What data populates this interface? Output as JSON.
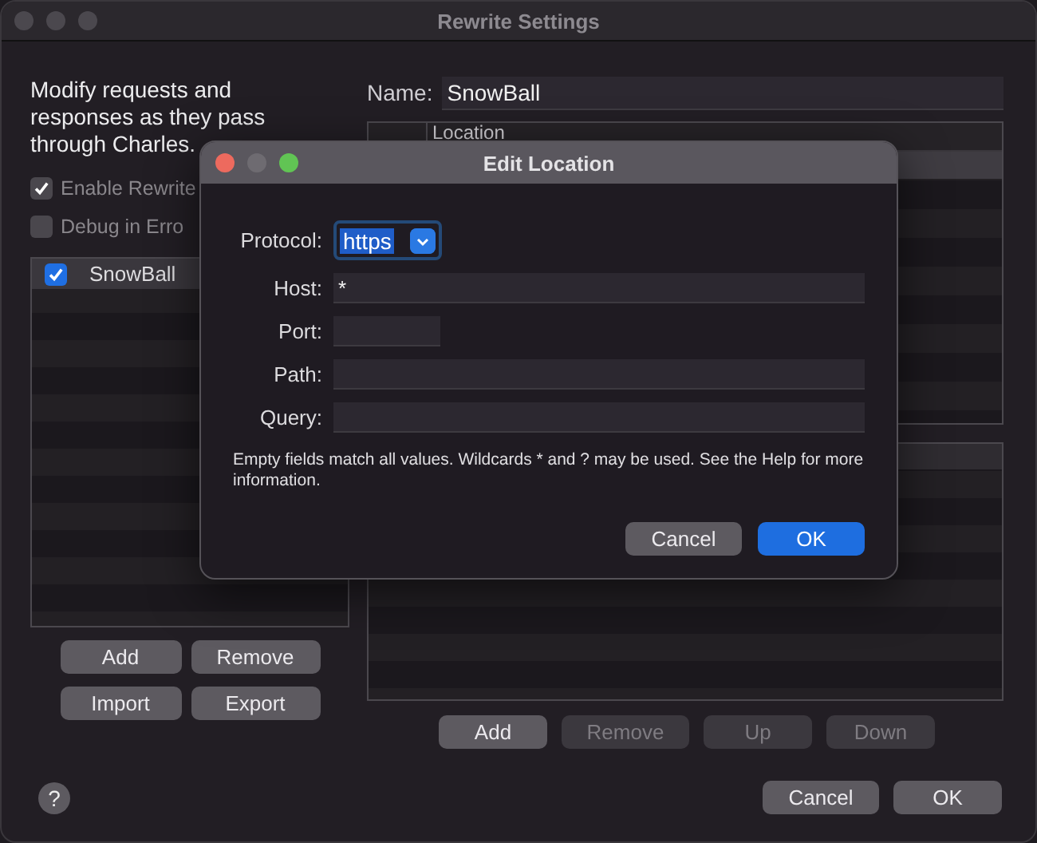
{
  "window": {
    "title": "Rewrite Settings"
  },
  "description": "Modify requests and responses as they pass through Charles.",
  "options": [
    {
      "label": "Enable Rewrite",
      "checked": true
    },
    {
      "label": "Debug in Erro",
      "checked": false
    }
  ],
  "sets": [
    {
      "name": "SnowBall",
      "checked": true,
      "selected": true
    }
  ],
  "set_buttons": [
    {
      "label": "Add",
      "disabled": false
    },
    {
      "label": "Remove",
      "disabled": false
    },
    {
      "label": "Import",
      "disabled": false
    },
    {
      "label": "Export",
      "disabled": false
    }
  ],
  "name_field": {
    "label": "Name:",
    "value": "SnowBall"
  },
  "locations_table": {
    "columns": [
      "Location"
    ]
  },
  "rule_buttons": [
    {
      "label": "Add",
      "disabled": false
    },
    {
      "label": "Remove",
      "disabled": true
    },
    {
      "label": "Up",
      "disabled": true
    },
    {
      "label": "Down",
      "disabled": true
    }
  ],
  "help": "?",
  "footer_buttons": [
    {
      "label": "Cancel",
      "default": false
    },
    {
      "label": "OK",
      "default": false
    }
  ],
  "dialog": {
    "title": "Edit Location",
    "fields": [
      {
        "label": "Protocol:",
        "kind": "select",
        "value": "https"
      },
      {
        "label": "Host:",
        "kind": "text",
        "value": "*"
      },
      {
        "label": "Port:",
        "kind": "short"
      },
      {
        "label": "Path:",
        "kind": "text"
      },
      {
        "label": "Query:",
        "kind": "text"
      }
    ],
    "note": "Empty fields match all values. Wildcards * and ? may be used. See the Help for more information.",
    "buttons": [
      {
        "label": "Cancel",
        "default": false
      },
      {
        "label": "OK",
        "default": true
      }
    ]
  }
}
